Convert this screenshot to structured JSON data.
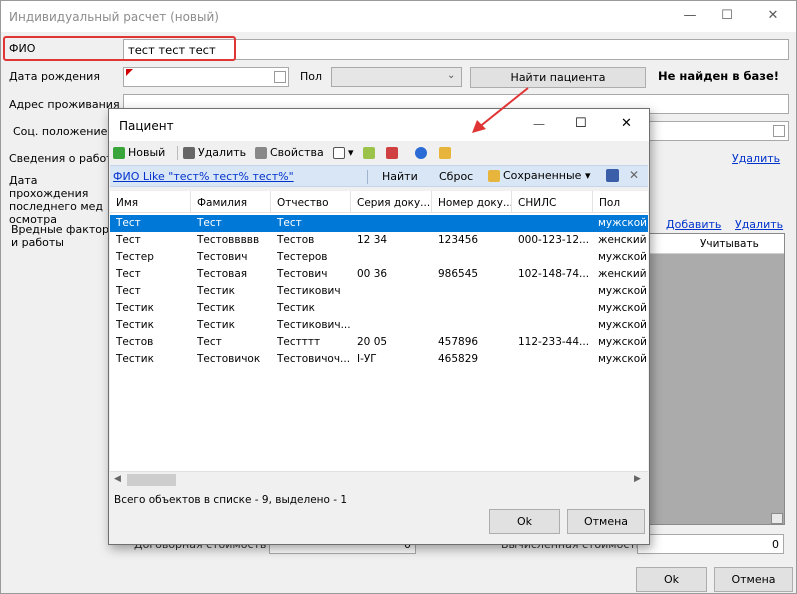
{
  "window": {
    "title": "Индивидуальный расчет (новый)",
    "minimize": "—",
    "maximize": "☐",
    "close": "✕"
  },
  "form": {
    "fio_label": "ФИО",
    "fio_value": "тест тест тест",
    "birth_label": "Дата рождения",
    "sex_label": "Пол",
    "find_button": "Найти пациента",
    "not_found": "Не найден в базе!",
    "address_label": "Адрес проживания",
    "social_label": "Соц. положение",
    "work_label": "Сведения о работе",
    "exam_label": "Дата прохождения последнего мед осмотра",
    "hazard_label": "Вредные факторы и работы",
    "delete_link_1": "Удалить",
    "add_link": "Добавить",
    "delete_link_2": "Удалить",
    "consider_header": "Учитывать",
    "contract_label": "Договорная стоимость",
    "contract_value": "0",
    "computed_label": "Вычисленная стоимость",
    "computed_value": "0",
    "ok": "Ok",
    "cancel": "Отмена"
  },
  "dialog": {
    "title": "Пациент",
    "maximize": "☐",
    "close": "✕",
    "toolbar": {
      "new": "Новый",
      "delete": "Удалить",
      "properties": "Свойства",
      "saved": "Сохраненные"
    },
    "filter": {
      "text": "ФИО Like \"тест% тест% тест%\"",
      "find": "Найти",
      "reset": "Сброс",
      "close": "✕"
    },
    "columns": [
      "Имя",
      "Фамилия",
      "Отчество",
      "Серия доку...",
      "Номер доку...",
      "СНИЛС",
      "Пол"
    ],
    "rows": [
      [
        "Тест",
        "Тест",
        "Тест",
        "",
        "",
        "",
        "мужской"
      ],
      [
        "Тест",
        "Тестоввввв",
        "Тестов",
        "12 34",
        "123456",
        "000-123-12...",
        "женский"
      ],
      [
        "Тестер",
        "Тестович",
        "Тестеров",
        "",
        "",
        "",
        "мужской"
      ],
      [
        "Тест",
        "Тестовая",
        "Тестович",
        "00 36",
        "986545",
        "102-148-74...",
        "женский"
      ],
      [
        "Тест",
        "Тестик",
        "Тестикович",
        "",
        "",
        "",
        "мужской"
      ],
      [
        "Тестик",
        "Тестик",
        "Тестик",
        "",
        "",
        "",
        "мужской"
      ],
      [
        "Тестик",
        "Тестик",
        "Тестикович...",
        "",
        "",
        "",
        "мужской"
      ],
      [
        "Тестов",
        "Тест",
        "Тестттт",
        "20 05",
        "457896",
        "112-233-44...",
        "мужской"
      ],
      [
        "Тестик",
        "Тестовичок",
        "Тестовичоч...",
        "І-УГ",
        "465829",
        "",
        "мужской"
      ]
    ],
    "selected_row": 0,
    "status": "Всего объектов в списке - 9, выделено - 1",
    "ok": "Ok",
    "cancel": "Отмена"
  }
}
